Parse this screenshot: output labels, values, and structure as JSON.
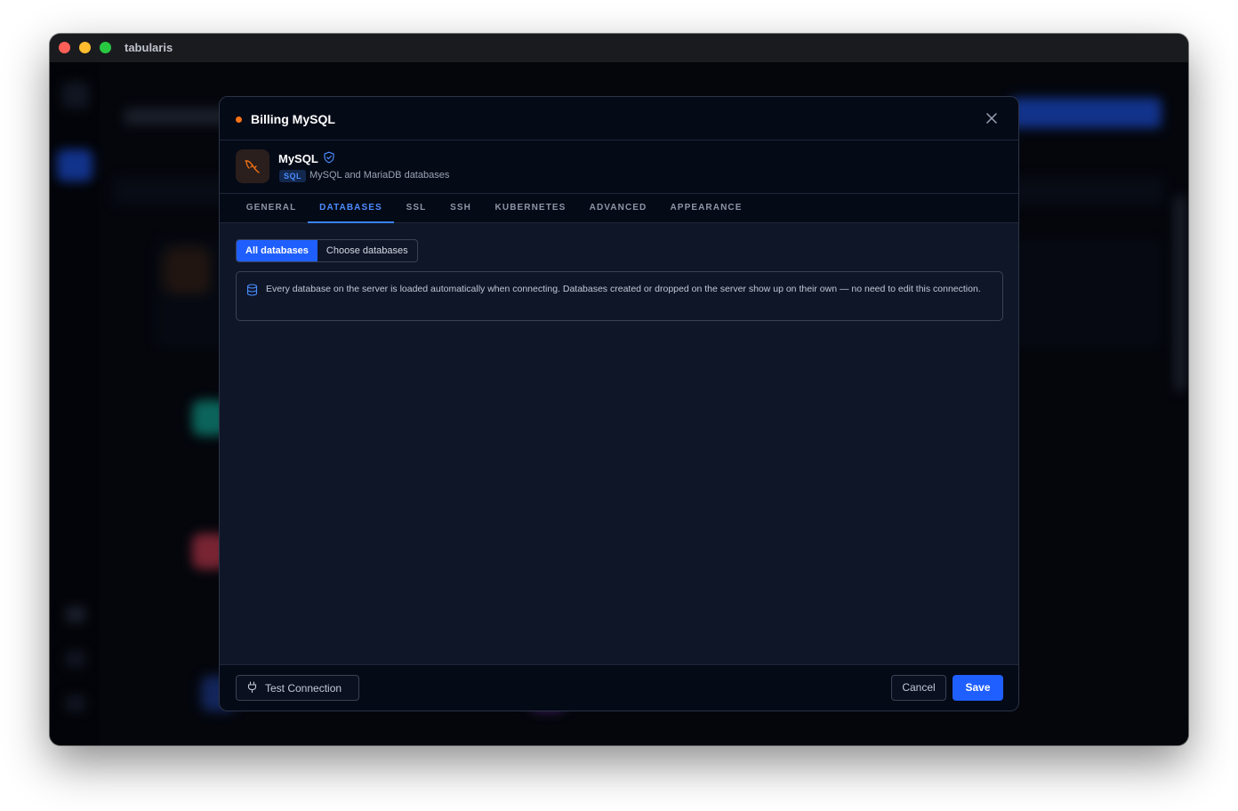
{
  "window": {
    "title": "tabularis"
  },
  "modal": {
    "title": "Billing MySQL",
    "driver": {
      "name": "MySQL",
      "badge": "SQL",
      "description": "MySQL and MariaDB databases"
    },
    "tabs": [
      {
        "label": "GENERAL",
        "active": false
      },
      {
        "label": "DATABASES",
        "active": true
      },
      {
        "label": "SSL",
        "active": false
      },
      {
        "label": "SSH",
        "active": false
      },
      {
        "label": "KUBERNETES",
        "active": false
      },
      {
        "label": "ADVANCED",
        "active": false
      },
      {
        "label": "APPEARANCE",
        "active": false
      }
    ],
    "mode": {
      "options": [
        "All databases",
        "Choose databases"
      ],
      "selected": "All databases"
    },
    "info_text": "Every database on the server is loaded automatically when connecting. Databases created or dropped on the server show up on their own — no need to edit this connection.",
    "footer": {
      "test_label": "Test Connection",
      "cancel_label": "Cancel",
      "save_label": "Save"
    }
  },
  "colors": {
    "accent": "#1f5fff",
    "status_dot": "#f97316",
    "driver_icon": "#f97316"
  }
}
